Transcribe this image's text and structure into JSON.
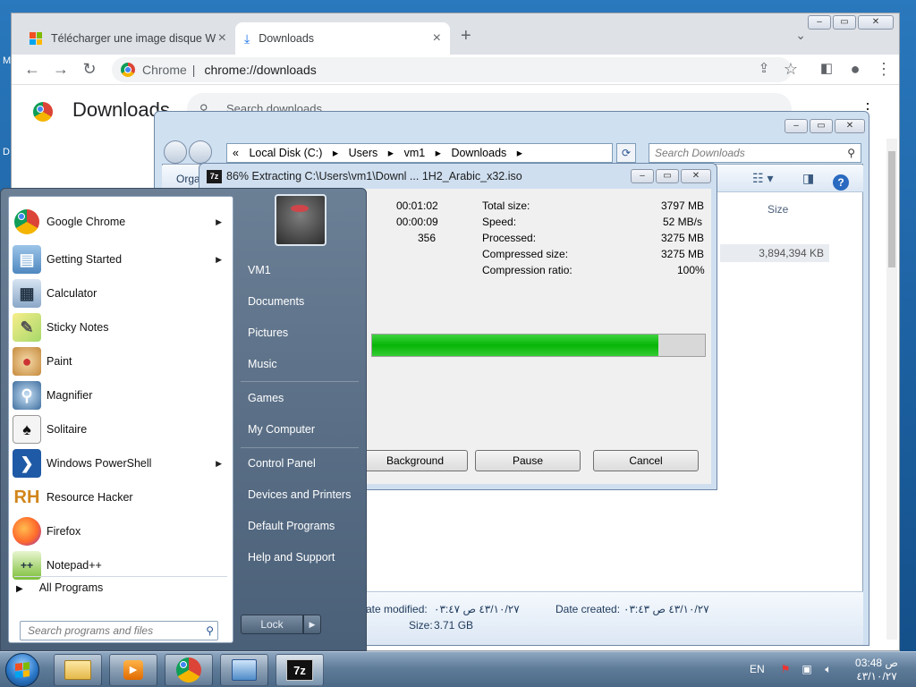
{
  "desktop": {
    "edge_letters": [
      "M",
      "D"
    ]
  },
  "chrome": {
    "tabs": [
      {
        "label": "Télécharger une image disque W",
        "icon": "microsoft-logo-icon"
      },
      {
        "label": "Downloads",
        "icon": "download-icon"
      }
    ],
    "omnibox": {
      "site_label": "Chrome",
      "url": "chrome://downloads"
    },
    "downloads_page": {
      "title": "Downloads",
      "search_placeholder": "Search downloads"
    }
  },
  "explorer": {
    "address": [
      "«",
      "Local Disk (C:)",
      "▸",
      "Users",
      "▸",
      "vm1",
      "▸",
      "Downloads",
      "▸"
    ],
    "search_placeholder": "Search Downloads",
    "organize_label": "Orga",
    "column_size": "Size",
    "file_size": "3,894,394 KB",
    "details": {
      "modified_label": "ate modified:",
      "modified_value": "٤٣/١٠/٢٧ ص ٠٣:٤٧",
      "created_label": "Date created:",
      "created_value": "٤٣/١٠/٢٧ ص ٠٣:٤٣",
      "size_label": "Size:",
      "size_value": "3.71 GB"
    }
  },
  "zip_dialog": {
    "title": "86% Extracting C:\\Users\\vm1\\Downl ... 1H2_Arabic_x32.iso",
    "left_values": [
      "00:01:02",
      "00:00:09",
      "356"
    ],
    "stats": [
      {
        "label": "Total size:",
        "value": "3797 MB"
      },
      {
        "label": "Speed:",
        "value": "52 MB/s"
      },
      {
        "label": "Processed:",
        "value": "3275 MB"
      },
      {
        "label": "Compressed size:",
        "value": "3275 MB"
      },
      {
        "label": "Compression ratio:",
        "value": "100%"
      }
    ],
    "progress": 0.86,
    "buttons": {
      "background": "Background",
      "pause": "Pause",
      "cancel": "Cancel"
    }
  },
  "start_menu": {
    "programs": [
      {
        "label": "Google Chrome",
        "has_submenu": true,
        "icon": "chrome-icon"
      },
      {
        "label": "Getting Started",
        "has_submenu": true,
        "icon": "getting-started-icon"
      },
      {
        "label": "Calculator",
        "has_submenu": false,
        "icon": "calculator-icon"
      },
      {
        "label": "Sticky Notes",
        "has_submenu": false,
        "icon": "sticky-notes-icon"
      },
      {
        "label": "Paint",
        "has_submenu": false,
        "icon": "paint-icon"
      },
      {
        "label": "Magnifier",
        "has_submenu": false,
        "icon": "magnifier-icon"
      },
      {
        "label": "Solitaire",
        "has_submenu": false,
        "icon": "solitaire-icon"
      },
      {
        "label": "Windows PowerShell",
        "has_submenu": true,
        "icon": "powershell-icon"
      },
      {
        "label": "Resource Hacker",
        "has_submenu": false,
        "icon": "resource-hacker-icon"
      },
      {
        "label": "Firefox",
        "has_submenu": false,
        "icon": "firefox-icon"
      },
      {
        "label": "Notepad++",
        "has_submenu": false,
        "icon": "notepadpp-icon"
      }
    ],
    "all_programs": "All Programs",
    "search_placeholder": "Search programs and files",
    "right_items": {
      "user": "VM1",
      "documents": "Documents",
      "pictures": "Pictures",
      "music": "Music",
      "games": "Games",
      "computer": "My Computer",
      "control_panel": "Control Panel",
      "devices": "Devices and Printers",
      "default_programs": "Default Programs",
      "help": "Help and Support"
    },
    "lock_label": "Lock"
  },
  "taskbar": {
    "apps": [
      "explorer-icon",
      "media-player-icon",
      "chrome-icon",
      "control-panel-icon",
      "7zip-icon"
    ],
    "lang": "EN",
    "time": "03:48 ص",
    "date": "٤٣/١٠/٢٧"
  },
  "colors": {
    "progress_fill": "#06b506",
    "taskbar": "#5f7c99",
    "start_menu": "#4a6078"
  }
}
